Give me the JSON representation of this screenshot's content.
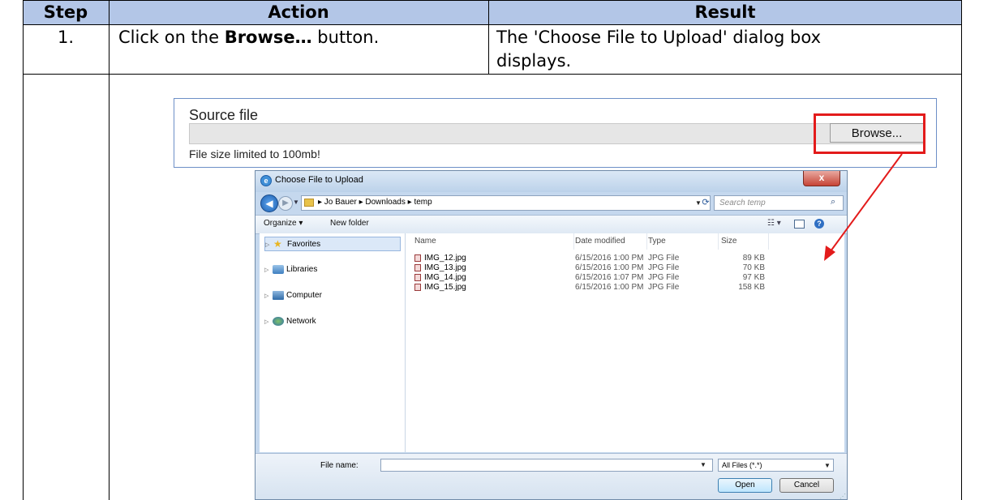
{
  "table": {
    "headers": [
      "Step",
      "Action",
      "Result"
    ],
    "row1": {
      "step": "1.",
      "action_pre": "Click on the ",
      "action_bold": "Browse…",
      "action_post": " button.",
      "result_line1": "The 'Choose File to Upload' dialog box",
      "result_line2": "displays."
    }
  },
  "source_panel": {
    "label": "Source file",
    "browse_label": "Browse...",
    "note": "File size limited to 100mb!"
  },
  "dialog": {
    "title": "Choose File to Upload",
    "close_label": "x",
    "breadcrumbs": "▸ Jo Bauer ▸ Downloads ▸ temp",
    "search_placeholder": "Search temp",
    "toolbar": {
      "organize": "Organize ▾",
      "new_folder": "New folder"
    },
    "nav": [
      {
        "label": "Favorites",
        "icon": "star-icon"
      },
      {
        "label": "Libraries",
        "icon": "library-icon"
      },
      {
        "label": "Computer",
        "icon": "computer-icon"
      },
      {
        "label": "Network",
        "icon": "network-icon"
      }
    ],
    "columns": [
      "Name",
      "Date modified",
      "Type",
      "Size"
    ],
    "files": [
      {
        "name": "IMG_12.jpg",
        "date": "6/15/2016 1:00 PM",
        "type": "JPG File",
        "size": "89 KB"
      },
      {
        "name": "IMG_13.jpg",
        "date": "6/15/2016 1:00 PM",
        "type": "JPG File",
        "size": "70 KB"
      },
      {
        "name": "IMG_14.jpg",
        "date": "6/15/2016 1:07 PM",
        "type": "JPG File",
        "size": "97 KB"
      },
      {
        "name": "IMG_15.jpg",
        "date": "6/15/2016 1:00 PM",
        "type": "JPG File",
        "size": "158 KB"
      }
    ],
    "filename_label": "File name:",
    "filename_value": "",
    "filter_value": "All Files (*.*)",
    "open_label": "Open",
    "cancel_label": "Cancel"
  },
  "colors": {
    "header_bg": "#b3c6e7",
    "highlight": "#e31b1b"
  }
}
